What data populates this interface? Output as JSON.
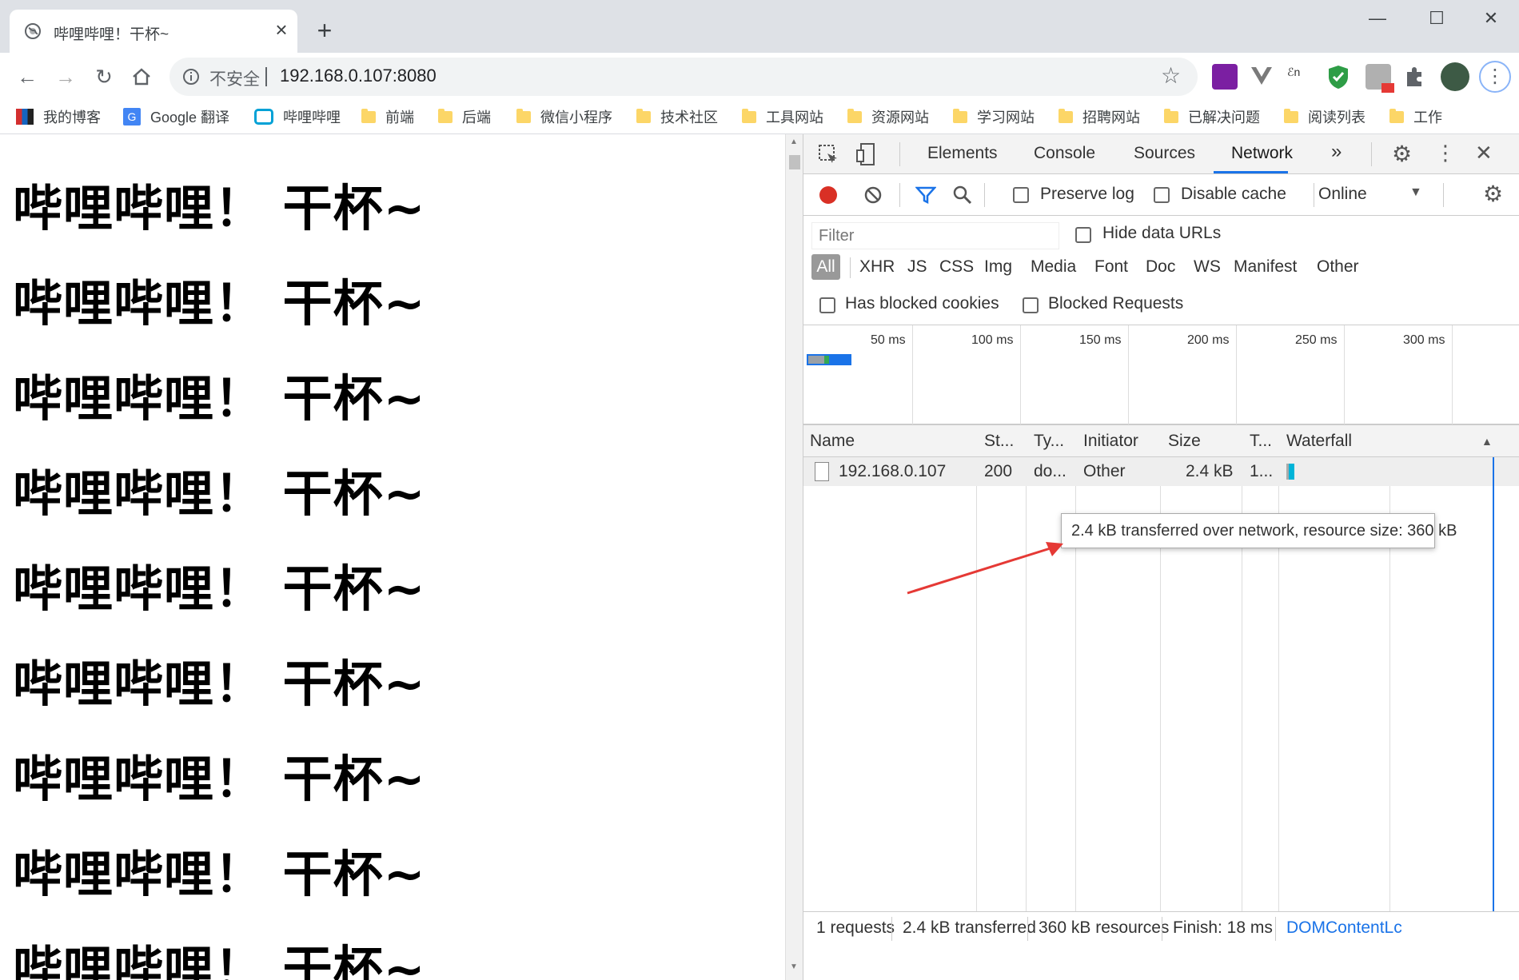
{
  "browser": {
    "tab_title": "哔哩哔哩！干杯~",
    "new_tab": "+",
    "window_controls": {
      "minimize": "—",
      "maximize": "☐",
      "close": "✕"
    },
    "toolbar": {
      "insecure_label": "不安全",
      "url": "192.168.0.107:8080"
    },
    "bookmarks": [
      {
        "label": "我的博客",
        "icon": "blog-icon"
      },
      {
        "label": "Google 翻译",
        "icon": "google-translate-icon"
      },
      {
        "label": "哔哩哔哩",
        "icon": "bilibili-icon"
      },
      {
        "label": "前端",
        "icon": "folder-icon"
      },
      {
        "label": "后端",
        "icon": "folder-icon"
      },
      {
        "label": "微信小程序",
        "icon": "folder-icon"
      },
      {
        "label": "技术社区",
        "icon": "folder-icon"
      },
      {
        "label": "工具网站",
        "icon": "folder-icon"
      },
      {
        "label": "资源网站",
        "icon": "folder-icon"
      },
      {
        "label": "学习网站",
        "icon": "folder-icon"
      },
      {
        "label": "招聘网站",
        "icon": "folder-icon"
      },
      {
        "label": "已解决问题",
        "icon": "folder-icon"
      },
      {
        "label": "阅读列表",
        "icon": "folder-icon"
      },
      {
        "label": "工作",
        "icon": "folder-icon"
      }
    ]
  },
  "page": {
    "lines": [
      "哔哩哔哩！ 干杯~",
      "哔哩哔哩！ 干杯~",
      "哔哩哔哩！ 干杯~",
      "哔哩哔哩！ 干杯~",
      "哔哩哔哩！ 干杯~",
      "哔哩哔哩！ 干杯~",
      "哔哩哔哩！ 干杯~",
      "哔哩哔哩！ 干杯~",
      "哔哩哔哩！ 干杯~"
    ]
  },
  "devtools": {
    "tabs": [
      "Elements",
      "Console",
      "Sources",
      "Network"
    ],
    "more_tabs": "»",
    "active_tab": "Network",
    "toolbar": {
      "preserve_log": "Preserve log",
      "disable_cache": "Disable cache",
      "throttle": "Online"
    },
    "filter": {
      "placeholder": "Filter",
      "hide_data_urls": "Hide data URLs",
      "types": [
        "All",
        "XHR",
        "JS",
        "CSS",
        "Img",
        "Media",
        "Font",
        "Doc",
        "WS",
        "Manifest",
        "Other"
      ],
      "has_blocked_cookies": "Has blocked cookies",
      "blocked_requests": "Blocked Requests"
    },
    "overview_ticks": [
      "50 ms",
      "100 ms",
      "150 ms",
      "200 ms",
      "250 ms",
      "300 ms"
    ],
    "table": {
      "headers": [
        "Name",
        "St...",
        "Ty...",
        "Initiator",
        "Size",
        "T...",
        "Waterfall"
      ],
      "rows": [
        {
          "name": "192.168.0.107",
          "status": "200",
          "type": "do...",
          "initiator": "Other",
          "size": "2.4 kB",
          "time": "1..."
        }
      ]
    },
    "tooltip": "2.4 kB transferred over network, resource size: 360 kB",
    "status_bar": {
      "requests": "1 requests",
      "transferred": "2.4 kB transferred",
      "resources": "360 kB resources",
      "finish": "Finish: 18 ms",
      "dcl": "DOMContentLc"
    }
  },
  "colors": {
    "accent": "#1a73e8",
    "record": "#d93025",
    "annotation_arrow": "#e53935"
  }
}
